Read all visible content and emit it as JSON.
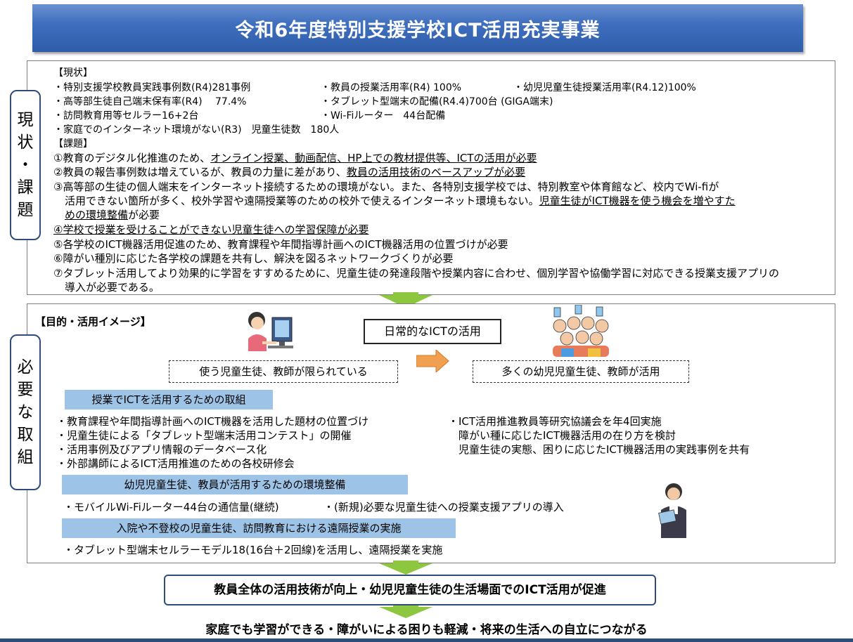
{
  "title": "令和6年度特別支援学校ICT活用充実事業",
  "side_top": [
    "現",
    "状",
    "・",
    "課",
    "題"
  ],
  "side_bottom": [
    "必",
    "要",
    "な",
    "取",
    "組"
  ],
  "status": {
    "heading": "【現状】",
    "rows": [
      [
        "・特別支援学校教員実践事例数(R4)281事例",
        "・教員の授業活用率(R4) 100%",
        "・幼児児童生徒授業活用率(R4.12)100%"
      ],
      [
        "・高等部生徒自己端末保有率(R4)　 77.4%",
        "・タブレット型端末の配備(R4.4)700台 (GIGA端末)",
        ""
      ],
      [
        "・訪問教育用等セルラー16+2台",
        "・Wi-Fiルーター　44台配備",
        ""
      ],
      [
        "・家庭でのインターネット環境がない(R3)　児童生徒数　180人",
        "",
        ""
      ]
    ]
  },
  "issues": {
    "heading": "【課題】",
    "i1_a": "①教育のデジタル化推進のため、",
    "i1_b": "オンライン授業、動画配信、HP上での教材提供等、ICTの活用が必要",
    "i2_a": "②教員の報告事例数は増えているが、教員の力量に差があり、",
    "i2_b": "教員の活用技術のベースアップが必要",
    "i3_l1": "③高等部の生徒の個人端末をインターネット接続するための環境がない。また、各特別支援学校では、特別教室や体育館など、校内でWi-fiが",
    "i3_l2a": "活用できない箇所が多く、校外学習や遠隔授業等のための校外で使えるインターネット環境もない。",
    "i3_l2b": "児童生徒がICT機器を使う機会を増やすた",
    "i3_l3": "めの環境整備",
    "i3_l3b": "が必要",
    "i4": "④学校で授業を受けることができない児童生徒への学習保障が必要",
    "i5": "⑤各学校のICT機器活用促進のため、教育課程や年間指導計画へのICT機器活用の位置づけが必要",
    "i6": "⑥障がい種別に応じた各学校の課題を共有し、解決を図るネットワークづくりが必要",
    "i7_l1": "⑦タブレット活用してより効果的に学習をすすめるために、児童生徒の発達段階や授業内容に合わせ、個別学習や協働学習に対応できる授業支援アプリの",
    "i7_l2": "導入が必要である。"
  },
  "purpose": {
    "heading": "【目的・活用イメージ】",
    "center_box": "日常的なICTの活用",
    "left_dash": "使う児童生徒、教師が限られている",
    "right_dash": "多くの幼児児童生徒、教師が活用"
  },
  "section1": {
    "label": "授業でICTを活用するための取組",
    "left": [
      "・教育課程や年間指導計画へのICT機器を活用した題材の位置づけ",
      "・児童生徒による「タブレット型端末活用コンテスト」の開催",
      "・活用事例及びアプリ情報のデータベース化",
      "・外部講師によるICT活用推進のための各校研修会"
    ],
    "right": [
      "・ICT活用推進教員等研究協議会を年4回実施",
      "　障がい種に応じたICT機器活用の在り方を検討",
      "　児童生徒の実態、困りに応じたICT機器活用の実践事例を共有"
    ]
  },
  "section2": {
    "label": "幼児児童生徒、教員が活用するための環境整備",
    "item1": "・モバイルWi-Fiルーター44台の通信量(継続)",
    "item2": "・(新規)必要な児童生徒への授業支援アプリの導入"
  },
  "section3": {
    "label": "入院や不登校の児童生徒、訪問教育における遠隔授業の実施",
    "item1": "・タブレット型端末セルラーモデル18(16台＋2回線)を活用し、遠隔授業を実施"
  },
  "result": "教員全体の活用技術が向上・幼児児童生徒の生活場面でのICT活用が促進",
  "final": "家庭でも学習ができる・障がいによる困りも軽減・将来の生活への自立につながる",
  "colors": {
    "title_blue": "#3f6fbf",
    "pill_blue": "#9dc3e6",
    "arrow_green": "#8dc63f",
    "orange_arrow": "#f0a050",
    "frame_navy": "#2f4d7a"
  }
}
